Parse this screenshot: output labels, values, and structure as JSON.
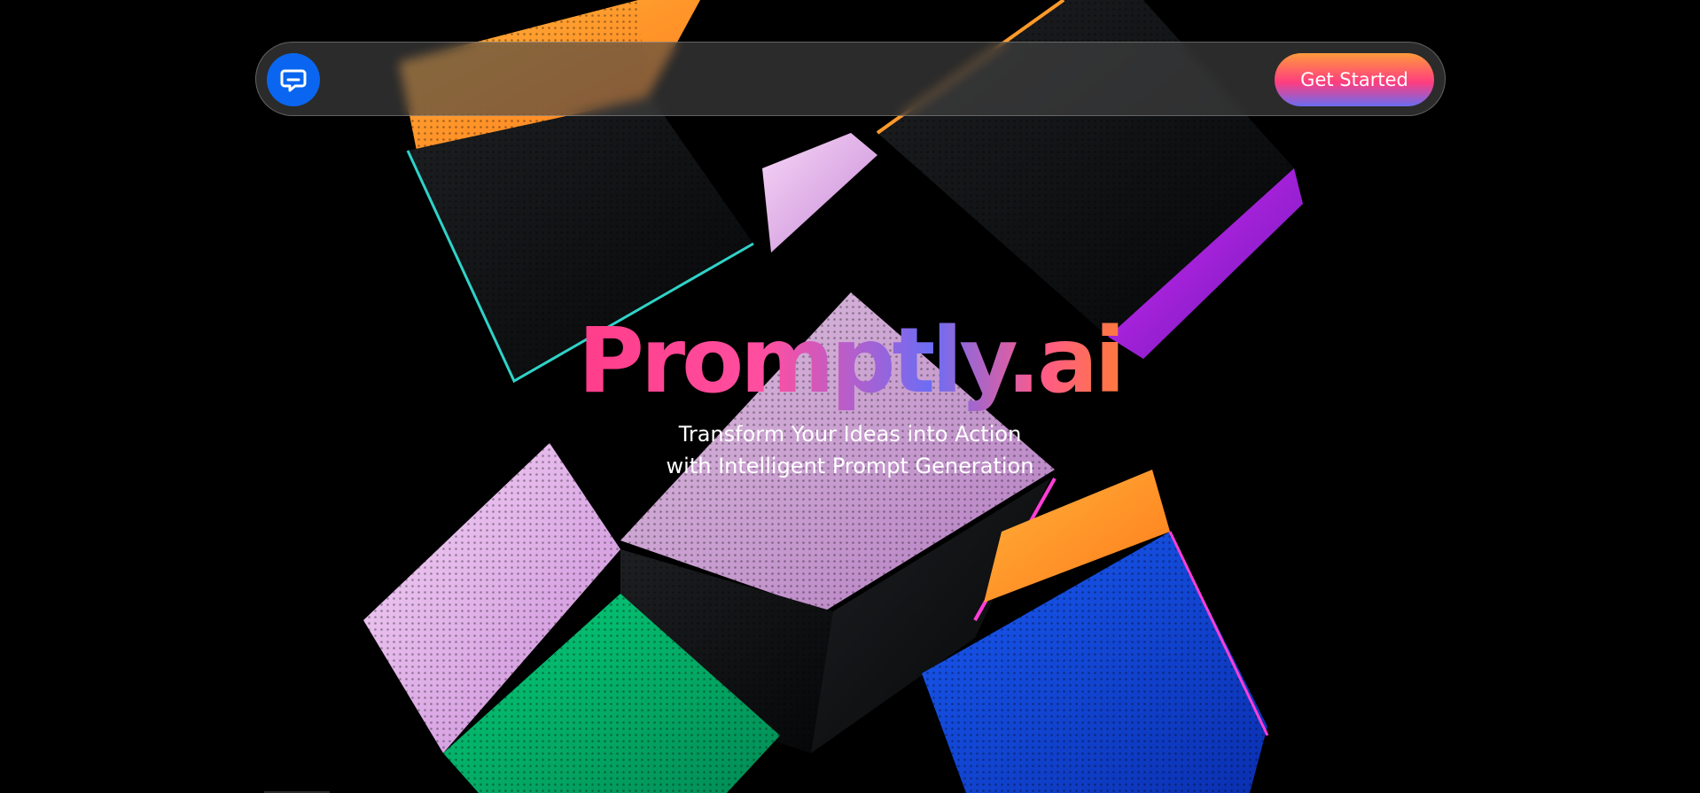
{
  "navbar": {
    "logo_icon": "chat-bubble-icon",
    "cta_label": "Get Started"
  },
  "hero": {
    "title": "Promptly.ai",
    "subtitle_line1": "Transform Your Ideas into Action",
    "subtitle_line2": "with Intelligent Prompt Generation"
  },
  "colors": {
    "background": "#000000",
    "logo_blue": "#0a66f0",
    "accent_pink": "#ff3d8a",
    "accent_orange": "#ff9a3c",
    "accent_purple": "#6b6df5"
  }
}
